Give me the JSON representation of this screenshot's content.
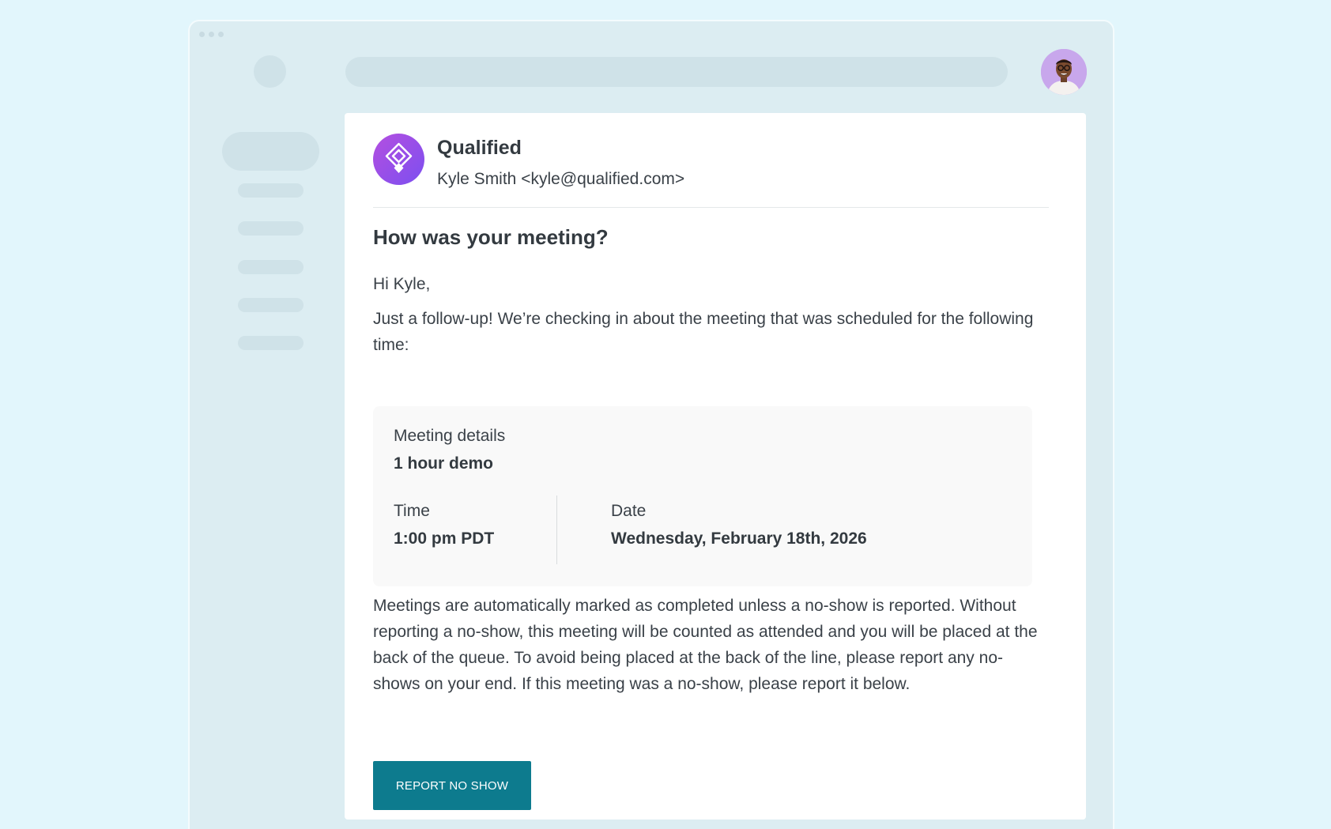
{
  "sender": {
    "name": "Qualified",
    "from": "Kyle Smith <kyle@qualified.com>"
  },
  "email": {
    "subject": "How was your meeting?",
    "greeting": "Hi Kyle,",
    "intro": "Just a follow-up! We’re checking in about the meeting that was scheduled for the following time:",
    "body": "Meetings are automatically marked as completed unless a no-show is reported. Without reporting a no-show, this meeting will be counted as attended and you will be placed at the back of the queue. To avoid being placed at the back of the line, please report any no-shows on your end. If this meeting was a no-show, please report it below.",
    "button_label": "REPORT NO SHOW"
  },
  "meeting": {
    "details_label": "Meeting details",
    "title": "1 hour demo",
    "time_label": "Time",
    "time_value": "1:00 pm PDT",
    "date_label": "Date",
    "date_value": "Wednesday, February 18th, 2026"
  },
  "colors": {
    "background": "#e2f6fc",
    "window": "#dcedf2",
    "placeholder": "#cfe2e8",
    "brand_gradient_start": "#b44fe0",
    "brand_gradient_end": "#7c4ff0",
    "button": "#0d7b8e"
  },
  "icons": {
    "sender_logo": "qualified-logo-icon",
    "user_avatar": "user-avatar-icon"
  }
}
